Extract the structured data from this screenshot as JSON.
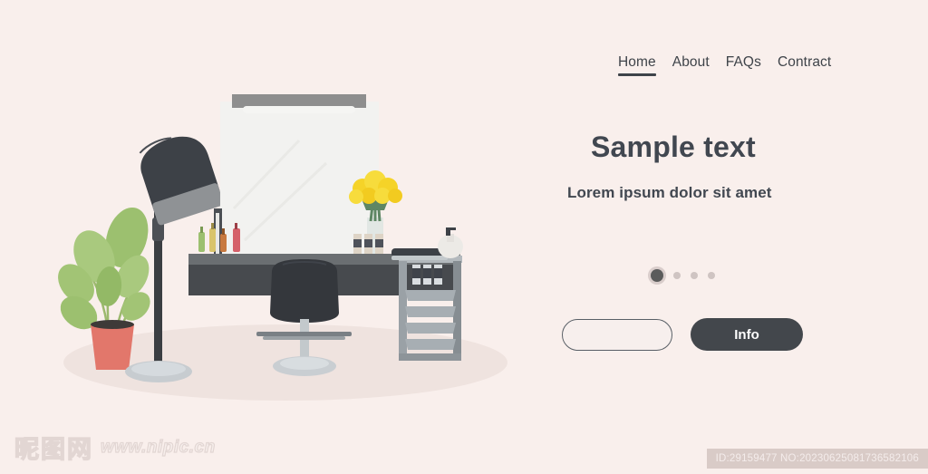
{
  "page": {
    "background_color": "#f9efec",
    "accent_dark": "#43474c",
    "text_color": "#414750"
  },
  "nav": {
    "items": [
      {
        "label": "Home",
        "active": true
      },
      {
        "label": "About",
        "active": false
      },
      {
        "label": "FAQs",
        "active": false
      },
      {
        "label": "Contract",
        "active": false
      }
    ]
  },
  "hero": {
    "headline": "Sample text",
    "subhead": "Lorem ipsum dolor sit amet"
  },
  "carousel": {
    "total": 4,
    "active_index": 0
  },
  "cta": {
    "outline_button_label": "",
    "solid_button_label": "Info"
  },
  "illustration": {
    "name": "beauty-salon-interior",
    "elements": [
      "potted-plant",
      "hood-dryer-lamp",
      "mirror",
      "vanity-desk",
      "salon-chair",
      "flower-vase",
      "cosmetic-bottles",
      "tool-trolley",
      "soap-dispenser"
    ],
    "colors": {
      "plant_leaf": "#9cc06f",
      "plant_pot": "#e2776b",
      "dryer_dark": "#3d4147",
      "dryer_rim": "#9a9a9a",
      "mirror_glass": "#f2f2f0",
      "mirror_top_bar": "#8e8e8e",
      "desk_top": "#6b6f72",
      "desk_front": "#474a4e",
      "chair": "#34373c",
      "chair_base": "#c3c9cc",
      "trolley": "#8d9499",
      "flower": "#f5d328",
      "floor_shadow": "#ece0dc"
    }
  },
  "watermark": {
    "site_cn": "昵图网",
    "site_url": "www.nipic.cn",
    "id_text": "ID:29159477 NO:20230625081736582106"
  }
}
